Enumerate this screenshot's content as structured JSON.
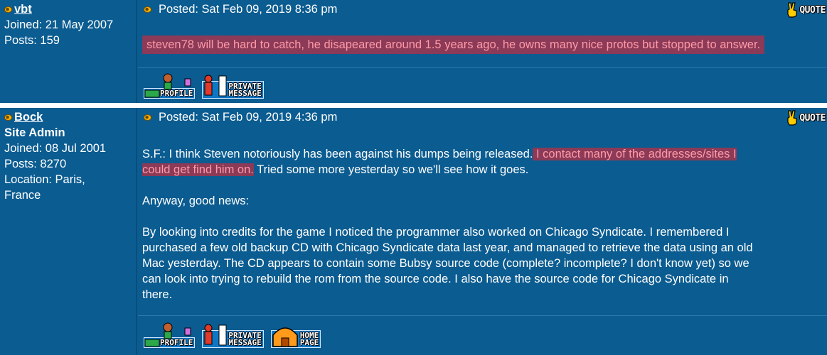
{
  "posts": [
    {
      "author": "vbt",
      "rank": "",
      "meta": [
        "Joined: 21 May 2007",
        "Posts: 159"
      ],
      "posted": "Posted: Sat Feb 09, 2019 8:36 pm",
      "quote_label": "QUOTE",
      "body_highlight": "steven78 will be hard to catch, he disapeared around 1.5 years ago, he owns many nice protos but stopped to answer.",
      "buttons": {
        "profile": "PROFILE",
        "pm_line1": "PRIVATE",
        "pm_line2": "MESSAGE"
      }
    },
    {
      "author": "Bock",
      "rank": "Site Admin",
      "meta": [
        "Joined: 08 Jul 2001",
        "Posts: 8270",
        "Location: Paris,",
        "France"
      ],
      "posted": "Posted: Sat Feb 09, 2019 4:36 pm",
      "quote_label": "QUOTE",
      "para1_before": "S.F.: I think Steven notoriously has been against his dumps being released.",
      "para1_highlight_a": " I contact many of the addresses/sites I",
      "para1_highlight_b": "could get find him on.",
      "para1_after": " Tried some more yesterday so we'll see how it goes.",
      "para2": "Anyway, good news:",
      "para3_lines": [
        "By looking into credits for the game I noticed the programmer also worked on Chicago Syndicate. I remembered I",
        "purchased a few old backup CD with Chicago Syndicate data last year, and managed to retrieve the data using an old",
        "Mac yesterday. The CD appears to contain some Bubsy source code (complete? incomplete? I don't know yet) so we",
        "can look into trying to rebuild the rom from the source code. I also have the source code for Chicago Syndicate in",
        "there."
      ],
      "buttons": {
        "profile": "PROFILE",
        "pm_line1": "PRIVATE",
        "pm_line2": "MESSAGE",
        "home_line1": "HOME",
        "home_line2": "PAGE"
      }
    }
  ]
}
